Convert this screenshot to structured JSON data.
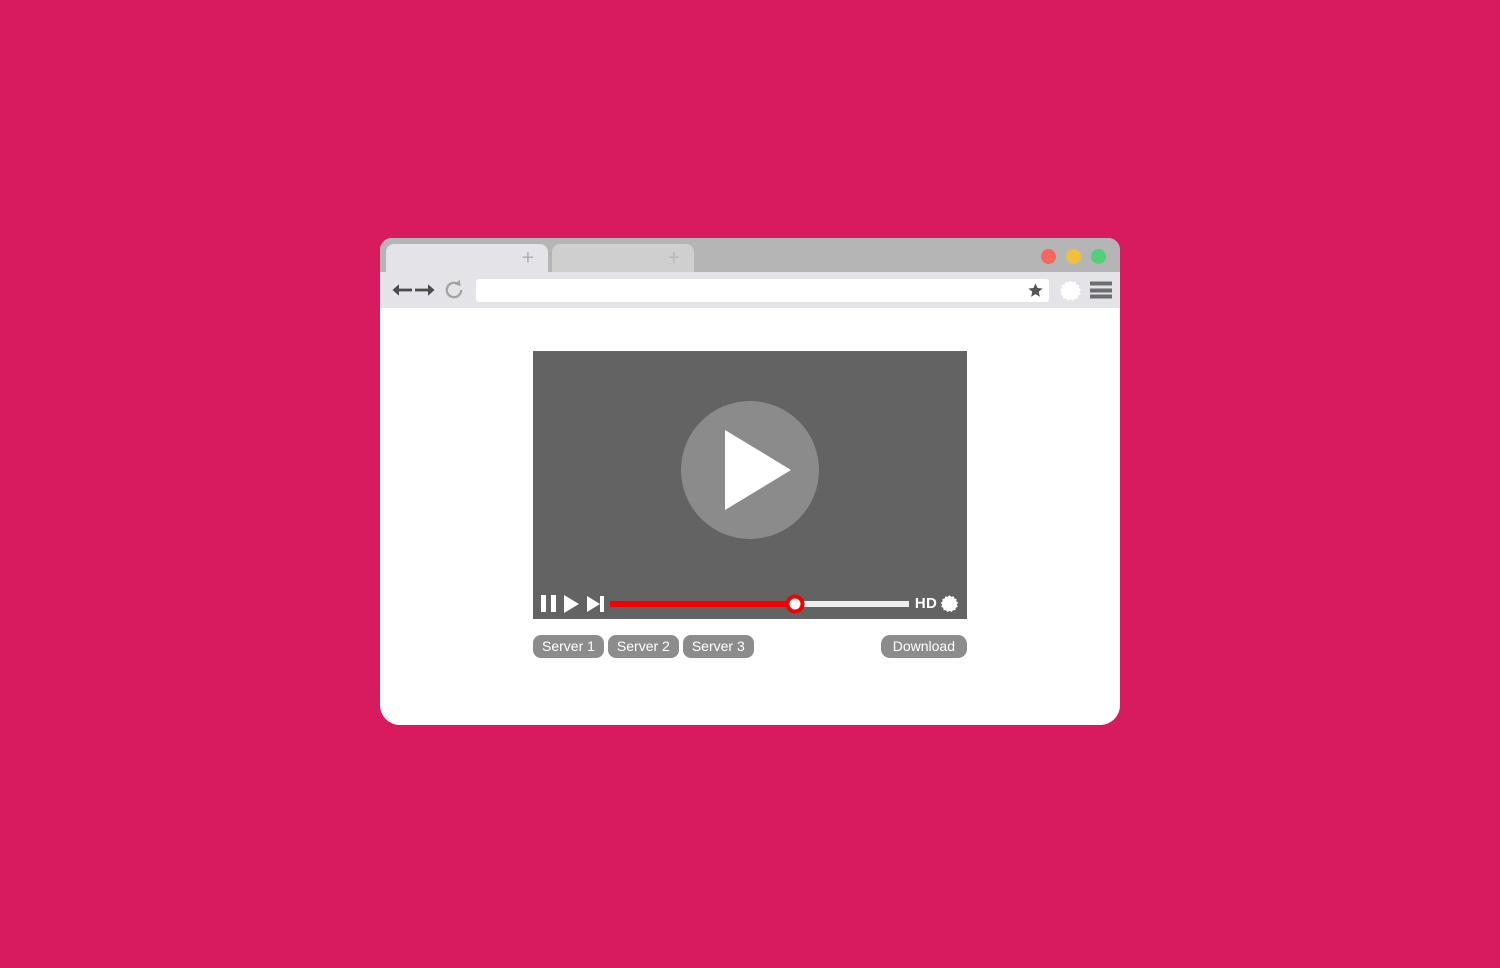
{
  "page": {
    "background_color": "#d81b5f"
  },
  "browser": {
    "window_color": "#ffffff",
    "tabstrip": {
      "background_color": "#b5b5b5",
      "tabs": [
        {
          "name": "tab-1",
          "label": "",
          "plus_glyph": "+",
          "active": true,
          "color": "#e4e4e8"
        },
        {
          "name": "tab-2",
          "label": "",
          "plus_glyph": "+",
          "active": false,
          "color": "#cfcfcf"
        }
      ]
    },
    "window_controls": [
      {
        "name": "close",
        "color": "#f4665e"
      },
      {
        "name": "minimize",
        "color": "#f0c03a"
      },
      {
        "name": "maximize",
        "color": "#53cf78"
      }
    ],
    "toolbar": {
      "background_color": "#e4e4e8",
      "back_icon": "back-arrow-icon",
      "forward_icon": "forward-arrow-icon",
      "reload_icon": "reload-icon",
      "address": {
        "value": "",
        "placeholder": ""
      },
      "bookmark_icon": "star-icon",
      "settings_icon": "gear-icon",
      "menu_icon": "hamburger-menu-icon"
    }
  },
  "video": {
    "stage_color": "#636363",
    "play_overlay": {
      "icon": "play-icon",
      "circle_color": "#8b8b8b",
      "triangle_color": "#ffffff"
    },
    "controls": {
      "pause_icon": "pause-icon",
      "play_icon": "play-icon",
      "next_icon": "next-track-icon",
      "progress": {
        "percent": 62,
        "filled_color": "#f40000",
        "track_color": "#ededed",
        "knob_color": "#ffffff"
      },
      "quality_label": "HD",
      "settings_icon": "gear-icon"
    }
  },
  "actions": {
    "servers": [
      {
        "label": "Server 1"
      },
      {
        "label": "Server 2"
      },
      {
        "label": "Server 3"
      }
    ],
    "download_label": "Download",
    "button_color": "#8c8c8c"
  }
}
